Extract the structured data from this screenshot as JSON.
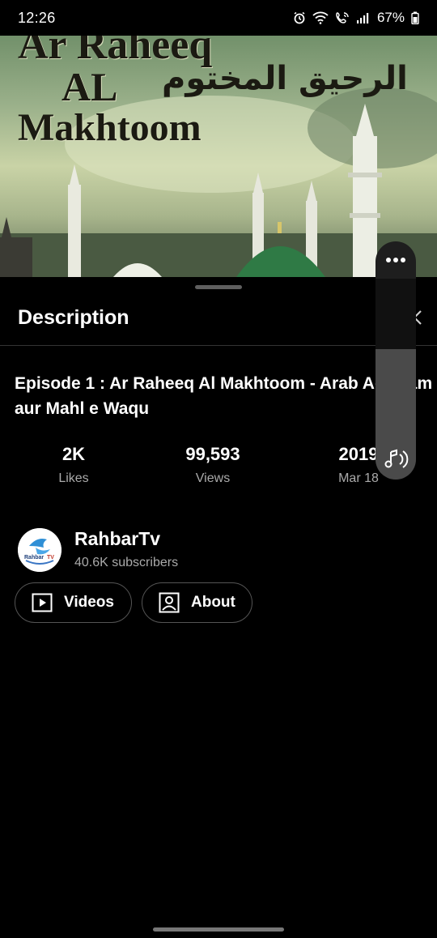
{
  "status_bar": {
    "time": "12:26",
    "battery": "67%",
    "icons": [
      "alarm-icon",
      "wifi-icon",
      "wifi-calling-icon",
      "signal-icon",
      "battery-icon"
    ]
  },
  "thumbnail": {
    "line1": "Ar Raheeq",
    "line2": "AL",
    "line3": "Makhtoom",
    "arabic": "الرحيق المختوم"
  },
  "sheet": {
    "title": "Description",
    "close_icon": "close-icon"
  },
  "video": {
    "title": "Episode 1 : Ar Raheeq Al Makhtoom - Arab Aqwaam aur Mahl e Waqu"
  },
  "stats": {
    "likes": {
      "value": "2K",
      "label": "Likes"
    },
    "views": {
      "value": "99,593",
      "label": "Views"
    },
    "date": {
      "value": "2019",
      "label": "Mar 18"
    }
  },
  "channel": {
    "name": "RahbarTv",
    "subscribers": "40.6K subscribers",
    "avatar_text": "Rahbar TV"
  },
  "buttons": {
    "videos": "Videos",
    "about": "About"
  },
  "volume": {
    "menu_icon": "more-icon",
    "icon": "music-volume-icon",
    "level": 0.65
  },
  "colors": {
    "background": "#000000",
    "panel": "#1e1e1e",
    "dome_green": "#2f7a45"
  }
}
